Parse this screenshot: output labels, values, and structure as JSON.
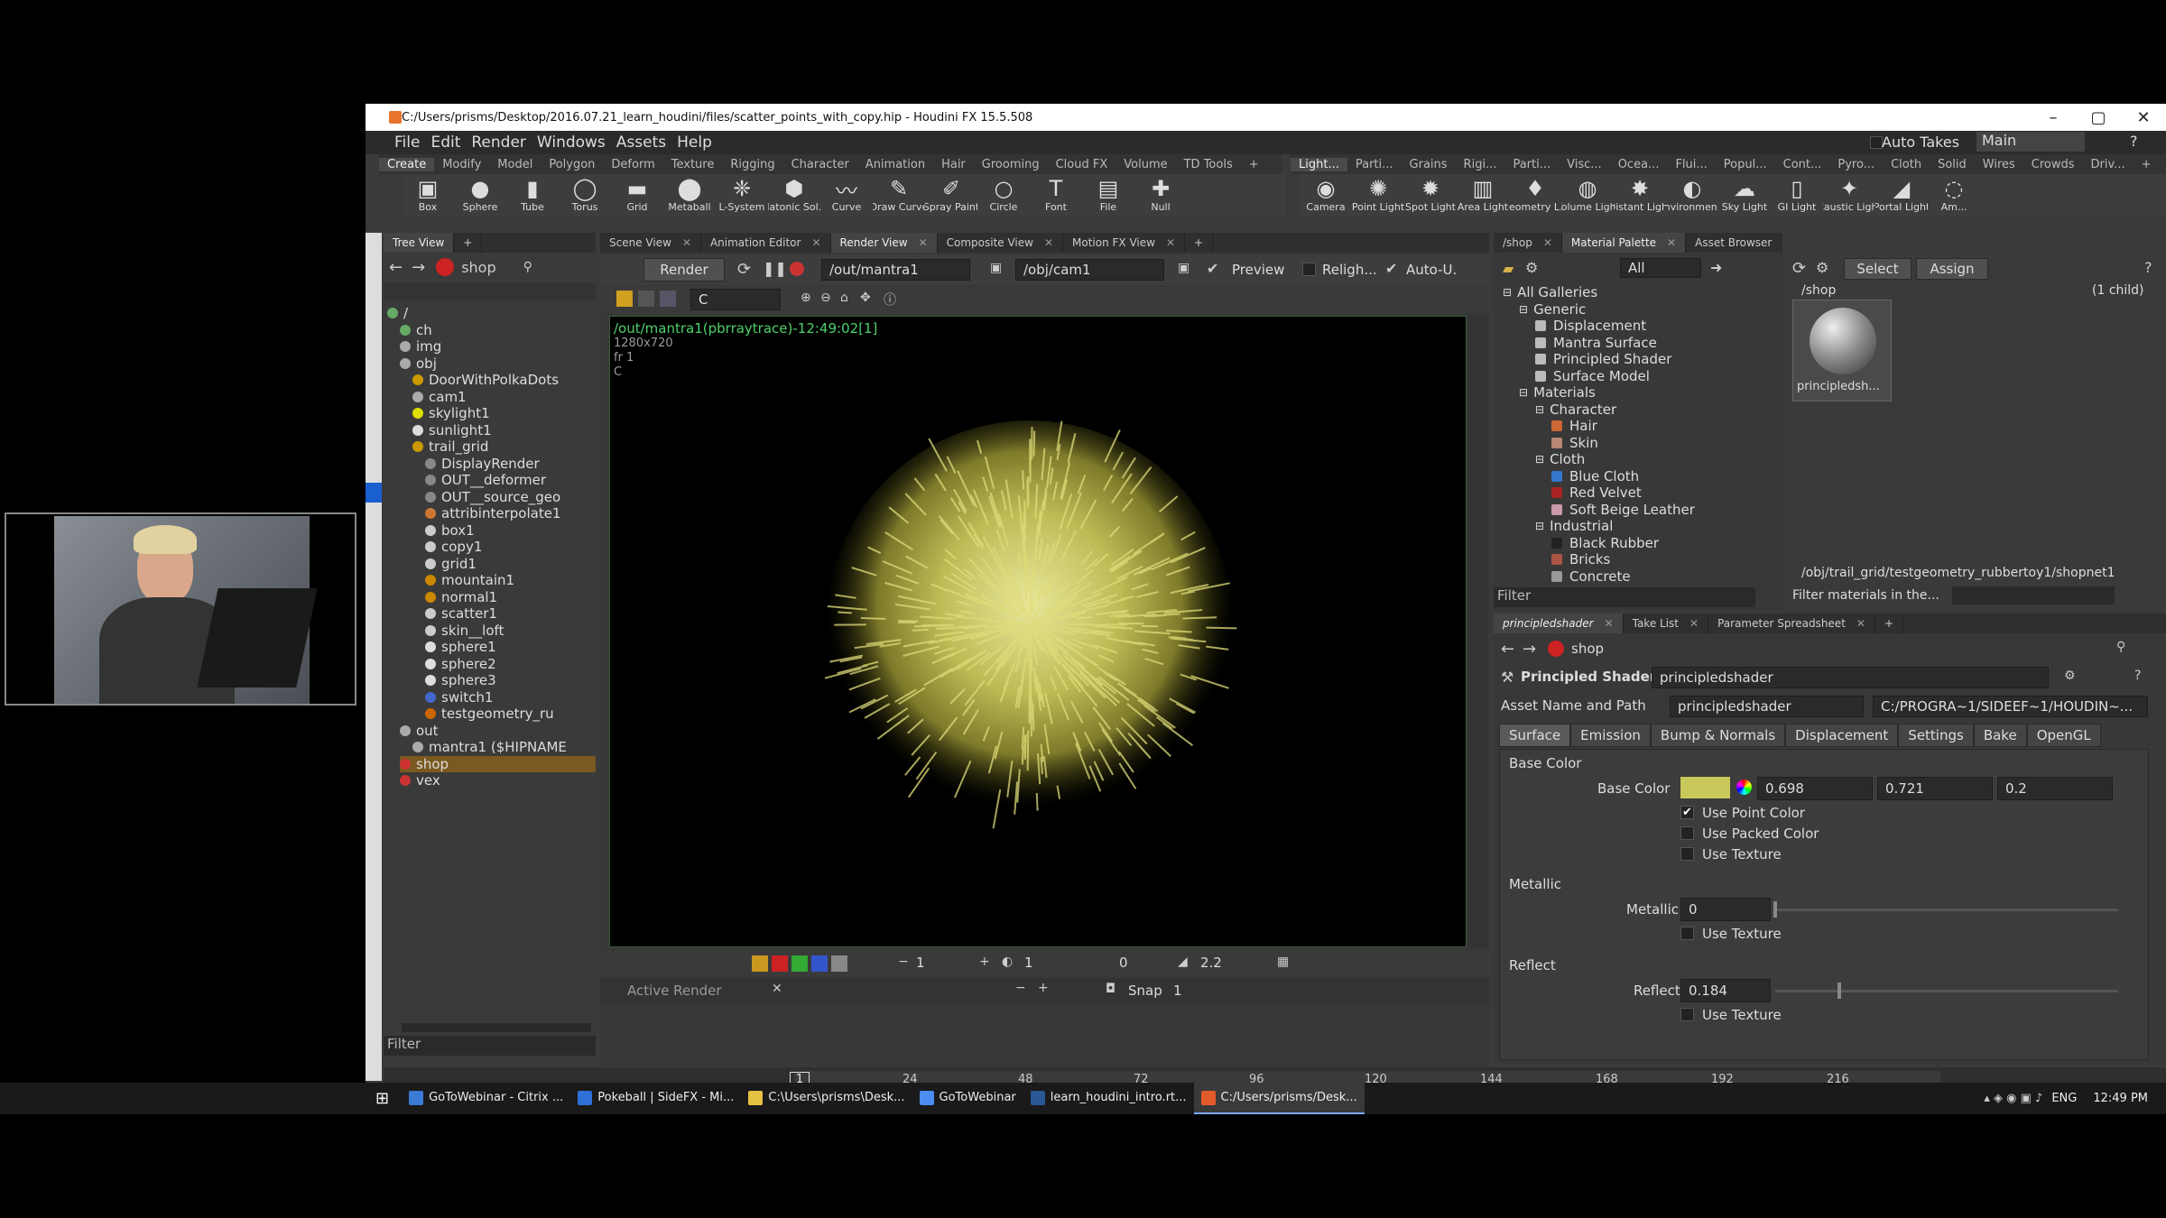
{
  "window": {
    "title": "C:/Users/prisms/Desktop/2016.07.21_learn_houdini/files/scatter_points_with_copy.hip - Houdini FX 15.5.508"
  },
  "menu": [
    "File",
    "Edit",
    "Render",
    "Windows",
    "Assets",
    "Help"
  ],
  "auto_takes": "Auto Takes",
  "desktop": "Main",
  "shelf_tabs_left": [
    "Create",
    "Modify",
    "Model",
    "Polygon",
    "Deform",
    "Texture",
    "Rigging",
    "Character",
    "Animation",
    "Hair",
    "Grooming",
    "Cloud FX",
    "Volume",
    "TD Tools",
    "+"
  ],
  "shelf_tabs_right": [
    "Light...",
    "Parti...",
    "Grains",
    "Rigi...",
    "Parti...",
    "Visc...",
    "Ocea...",
    "Flui...",
    "Popul...",
    "Cont...",
    "Pyro...",
    "Cloth",
    "Solid",
    "Wires",
    "Crowds",
    "Driv...",
    "+"
  ],
  "tools_left": [
    {
      "label": "Box",
      "icon": "▣"
    },
    {
      "label": "Sphere",
      "icon": "●"
    },
    {
      "label": "Tube",
      "icon": "▮"
    },
    {
      "label": "Torus",
      "icon": "◯"
    },
    {
      "label": "Grid",
      "icon": "▬"
    },
    {
      "label": "Metaball",
      "icon": "⬤"
    },
    {
      "label": "L-System",
      "icon": "❈"
    },
    {
      "label": "Platonic Sol...",
      "icon": "⬢"
    },
    {
      "label": "Curve",
      "icon": "〰"
    },
    {
      "label": "Draw Curve",
      "icon": "✎"
    },
    {
      "label": "Spray Paint",
      "icon": "✐"
    },
    {
      "label": "Circle",
      "icon": "○"
    },
    {
      "label": "Font",
      "icon": "T"
    },
    {
      "label": "File",
      "icon": "▤"
    },
    {
      "label": "Null",
      "icon": "✚"
    }
  ],
  "tools_right": [
    {
      "label": "Camera",
      "icon": "◉"
    },
    {
      "label": "Point Light",
      "icon": "✺"
    },
    {
      "label": "Spot Light",
      "icon": "✹"
    },
    {
      "label": "Area Light",
      "icon": "▥"
    },
    {
      "label": "Geometry L...",
      "icon": "♦"
    },
    {
      "label": "Volume Light",
      "icon": "◍"
    },
    {
      "label": "Distant Light",
      "icon": "✸"
    },
    {
      "label": "Environmen...",
      "icon": "◐"
    },
    {
      "label": "Sky Light",
      "icon": "☁"
    },
    {
      "label": "GI Light",
      "icon": "▯"
    },
    {
      "label": "Caustic Light",
      "icon": "✦"
    },
    {
      "label": "Portal Light",
      "icon": "◢"
    },
    {
      "label": "Am...",
      "icon": "◌"
    }
  ],
  "tree_panel": {
    "tab": "Tree View",
    "context": "shop",
    "filter": "Filter",
    "rows": [
      {
        "label": "/",
        "indent": 0,
        "color": "#6a6"
      },
      {
        "label": "ch",
        "indent": 1,
        "color": "#6a6"
      },
      {
        "label": "img",
        "indent": 1,
        "color": "#aaa"
      },
      {
        "label": "obj",
        "indent": 1,
        "color": "#aaa"
      },
      {
        "label": "DoorWithPolkaDots",
        "indent": 2,
        "color": "#c90"
      },
      {
        "label": "cam1",
        "indent": 2,
        "color": "#aaa"
      },
      {
        "label": "skylight1",
        "indent": 2,
        "color": "#dd0"
      },
      {
        "label": "sunlight1",
        "indent": 2,
        "color": "#ddd"
      },
      {
        "label": "trail_grid",
        "indent": 2,
        "color": "#c90"
      },
      {
        "label": "DisplayRender",
        "indent": 3,
        "color": "#888"
      },
      {
        "label": "OUT__deformer",
        "indent": 3,
        "color": "#888"
      },
      {
        "label": "OUT__source_geo",
        "indent": 3,
        "color": "#888"
      },
      {
        "label": "attribinterpolate1",
        "indent": 3,
        "color": "#c73"
      },
      {
        "label": "box1",
        "indent": 3,
        "color": "#ccc"
      },
      {
        "label": "copy1",
        "indent": 3,
        "color": "#ccc"
      },
      {
        "label": "grid1",
        "indent": 3,
        "color": "#ccc"
      },
      {
        "label": "mountain1",
        "indent": 3,
        "color": "#c80"
      },
      {
        "label": "normal1",
        "indent": 3,
        "color": "#c80"
      },
      {
        "label": "scatter1",
        "indent": 3,
        "color": "#ccc"
      },
      {
        "label": "skin__loft",
        "indent": 3,
        "color": "#ccc"
      },
      {
        "label": "sphere1",
        "indent": 3,
        "color": "#ddd"
      },
      {
        "label": "sphere2",
        "indent": 3,
        "color": "#ddd"
      },
      {
        "label": "sphere3",
        "indent": 3,
        "color": "#ddd"
      },
      {
        "label": "switch1",
        "indent": 3,
        "color": "#46c"
      },
      {
        "label": "testgeometry_ru",
        "indent": 3,
        "color": "#c60"
      },
      {
        "label": "out",
        "indent": 1,
        "color": "#aaa"
      },
      {
        "label": "mantra1 ($HIPNAME",
        "indent": 2,
        "color": "#aaa"
      },
      {
        "label": "shop",
        "indent": 1,
        "color": "#c33",
        "selected": true
      },
      {
        "label": "vex",
        "indent": 1,
        "color": "#c33"
      }
    ]
  },
  "view_tabs": [
    {
      "label": "Scene View",
      "active": false
    },
    {
      "label": "Animation Editor",
      "active": false
    },
    {
      "label": "Render View",
      "active": true
    },
    {
      "label": "Composite View",
      "active": false
    },
    {
      "label": "Motion FX View",
      "active": false
    }
  ],
  "render_bar": {
    "render": "Render",
    "output": "/out/mantra1",
    "camera": "/obj/cam1",
    "preview": "Preview",
    "relight": "Religh...",
    "auto": "Auto-U.",
    "channel": "C"
  },
  "render_info": {
    "line1": "/out/mantra1(pbrraytrace)-12:49:02[1]",
    "line2": "1280x720",
    "line3": "fr 1",
    "line4": "C"
  },
  "render_bottom": {
    "frame": "1",
    "exposure": "1",
    "offset": "0",
    "gamma": "2.2",
    "active": "Active Render",
    "snap": "Snap",
    "snap_val": "1"
  },
  "timeline": {
    "ticks": [
      "24",
      "48",
      "72",
      "96",
      "120",
      "144",
      "168",
      "192",
      "216"
    ],
    "current": "1"
  },
  "gallery": {
    "tabs": [
      "/shop",
      "Material Palette",
      "Asset Browser"
    ],
    "filter_all": "All",
    "filter": "Filter",
    "rows": [
      {
        "label": "All Galleries",
        "indent": 0,
        "sw": ""
      },
      {
        "label": "Generic",
        "indent": 1,
        "sw": ""
      },
      {
        "label": "Displacement",
        "indent": 2,
        "sw": "#bbb"
      },
      {
        "label": "Mantra Surface",
        "indent": 2,
        "sw": "#bbb"
      },
      {
        "label": "Principled Shader",
        "indent": 2,
        "sw": "#bbb"
      },
      {
        "label": "Surface Model",
        "indent": 2,
        "sw": "#bbb"
      },
      {
        "label": "Materials",
        "indent": 1,
        "sw": ""
      },
      {
        "label": "Character",
        "indent": 2,
        "sw": ""
      },
      {
        "label": "Hair",
        "indent": 3,
        "sw": "#c63"
      },
      {
        "label": "Skin",
        "indent": 3,
        "sw": "#b87"
      },
      {
        "label": "Cloth",
        "indent": 2,
        "sw": ""
      },
      {
        "label": "Blue Cloth",
        "indent": 3,
        "sw": "#37c"
      },
      {
        "label": "Red Velvet",
        "indent": 3,
        "sw": "#a22"
      },
      {
        "label": "Soft Beige Leather",
        "indent": 3,
        "sw": "#c9a"
      },
      {
        "label": "Industrial",
        "indent": 2,
        "sw": ""
      },
      {
        "label": "Black Rubber",
        "indent": 3,
        "sw": "#222"
      },
      {
        "label": "Bricks",
        "indent": 3,
        "sw": "#a54"
      },
      {
        "label": "Concrete",
        "indent": 3,
        "sw": "#999"
      }
    ]
  },
  "palette": {
    "select": "Select",
    "assign": "Assign",
    "path": "/shop",
    "children": "(1 child)",
    "thumb_label": "principledsh...",
    "bottom_path": "/obj/trail_grid/testgeometry_rubbertoy1/shopnet1",
    "filter_label": "Filter materials in the..."
  },
  "params": {
    "tabs": [
      "principledshader",
      "Take List",
      "Parameter Spreadsheet"
    ],
    "context": "shop",
    "node_type": "Principled Shader",
    "node_name": "principledshader",
    "asset_label": "Asset Name and Path",
    "asset_value": "principledshader",
    "asset_path": "C:/PROGRA~1/SIDEEF~1/HOUDIN~...",
    "section_tabs": [
      "Surface",
      "Emission",
      "Bump & Normals",
      "Displacement",
      "Settings",
      "Bake",
      "OpenGL"
    ],
    "base_color_section": "Base Color",
    "base_color_label": "Base Color",
    "base_color": [
      "0.698",
      "0.721",
      "0.2"
    ],
    "base_color_swatch": "#c9c85a",
    "use_point_color": "Use Point Color",
    "use_packed_color": "Use Packed Color",
    "use_texture": "Use Texture",
    "metallic_section": "Metallic",
    "metallic_label": "Metallic",
    "metallic": "0",
    "metallic_texture": "Use Texture",
    "reflect_section": "Reflect",
    "reflect_label": "Reflect",
    "reflect": "0.184",
    "reflect_texture": "Use Texture"
  },
  "taskbar": {
    "items": [
      {
        "label": "GoToWebinar - Citrix ...",
        "color": "#3a7bd5",
        "active": false
      },
      {
        "label": "Pokeball | SideFX - Mi...",
        "color": "#2e6fd8",
        "active": false
      },
      {
        "label": "C:\\Users\\prisms\\Desk...",
        "color": "#e6c243",
        "active": false
      },
      {
        "label": "GoToWebinar",
        "color": "#4b8df0",
        "active": false
      },
      {
        "label": "learn_houdini_intro.rt...",
        "color": "#2b5797",
        "active": false
      },
      {
        "label": "C:/Users/prisms/Desk...",
        "color": "#e35b2b",
        "active": true
      }
    ],
    "lang": "ENG",
    "clock": "12:49 PM"
  }
}
